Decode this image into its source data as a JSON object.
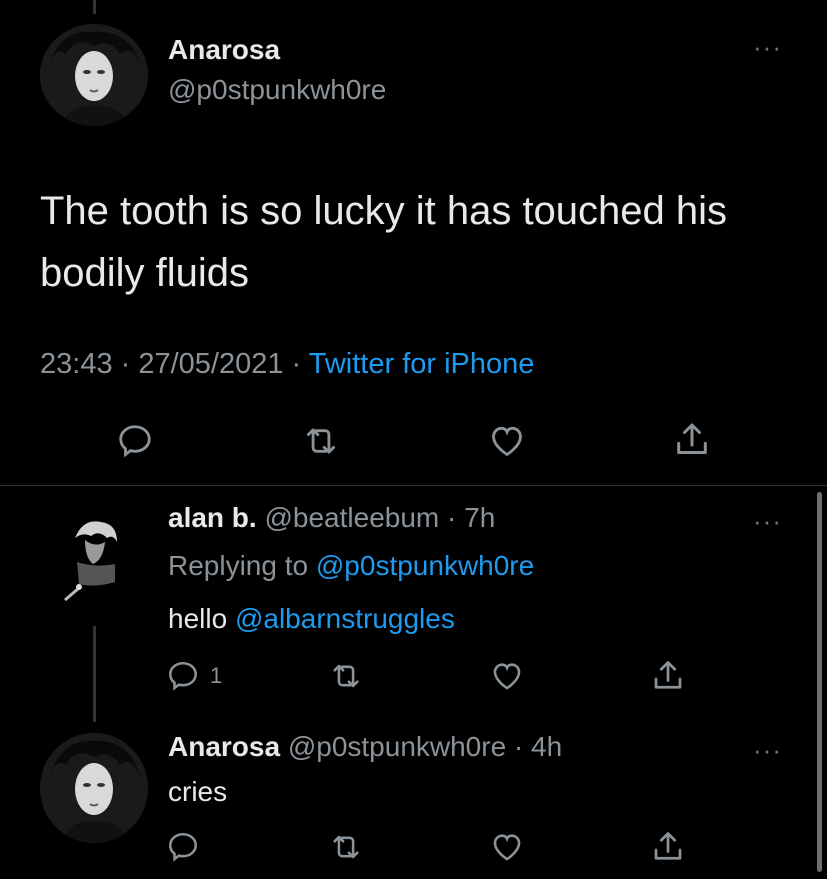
{
  "main_tweet": {
    "name": "Anarosa",
    "handle": "@p0stpunkwh0re",
    "text_line1": "The tooth is so lucky it has touched his",
    "text_line2": "bodily fluids",
    "time": "23:43 · 27/05/2021 ·",
    "source": "Twitter for iPhone",
    "more": "···",
    "icons": [
      "reply-icon",
      "retweet-icon",
      "like-icon",
      "share-icon"
    ]
  },
  "reply1": {
    "name": "alan b.",
    "handle_time": "@beatleebum · 7h",
    "replying_prefix": "Replying to",
    "replying_handle": "@p0stpunkwh0re",
    "text": "hello",
    "mention": "@albarnstruggles",
    "reply_count": "1",
    "more": "···"
  },
  "reply2": {
    "name": "Anarosa",
    "handle_time": "@p0stpunkwh0re · 4h",
    "text": "cries",
    "more": "···"
  },
  "colors": {
    "background": "#000000",
    "accent": "#1d9bf0",
    "secondary_text": "#8b9298",
    "icon": "#71767b"
  }
}
